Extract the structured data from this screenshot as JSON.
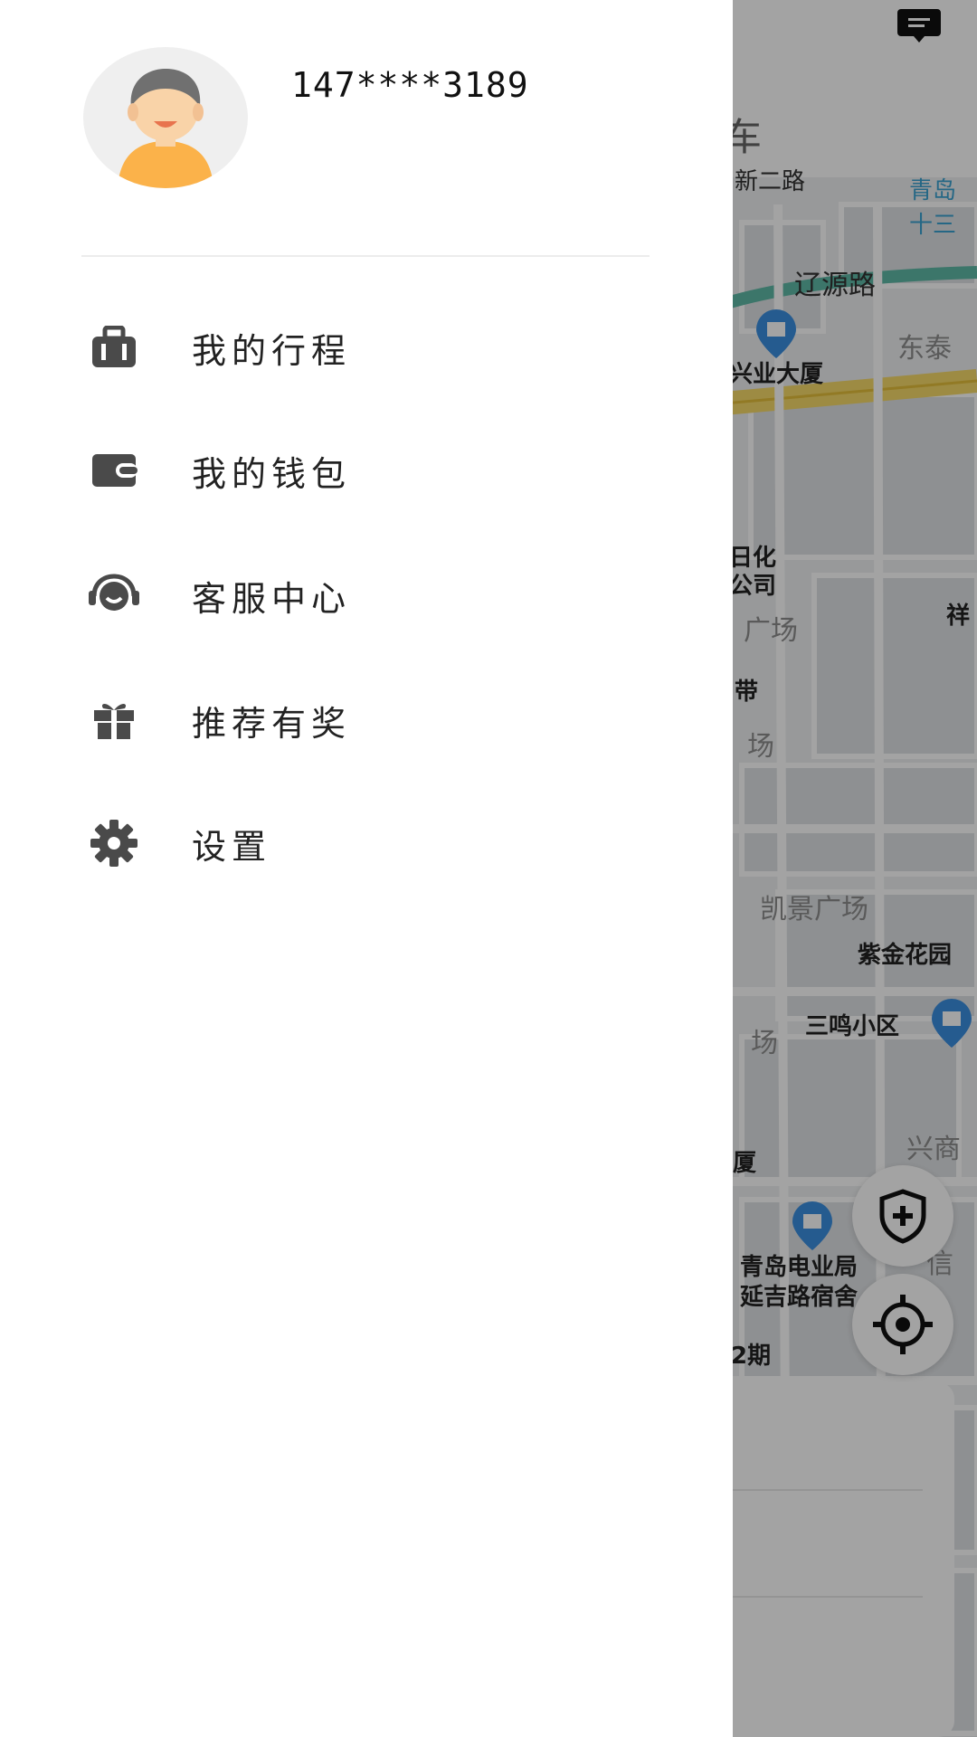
{
  "map": {
    "topbar_text": "车",
    "labels": {
      "road1": "新二路",
      "road2": "辽源路",
      "qd": "青岛",
      "sh": "十三",
      "dongtai": "东泰",
      "xingye": "兴业大厦",
      "rihua": "日化",
      "gongsi": "公司",
      "guangchang1": "广场",
      "xiang": "祥",
      "dai": "带",
      "guangchang2": "场",
      "kaijing": "凯景广场",
      "zijin": "紫金花园",
      "sanming": "三鸣小区",
      "guangchang3": "场",
      "xingshang": "兴商",
      "xia": "厦",
      "dianye": "青岛电业局",
      "yanji": "延吉路宿舍",
      "qi": "2期",
      "xin": "信"
    }
  },
  "user": {
    "phone": "147****3189"
  },
  "menu": {
    "items": [
      {
        "label": "我的行程",
        "icon": "suitcase-icon"
      },
      {
        "label": "我的钱包",
        "icon": "wallet-icon"
      },
      {
        "label": "客服中心",
        "icon": "headset-icon"
      },
      {
        "label": "推荐有奖",
        "icon": "gift-icon"
      },
      {
        "label": "设置",
        "icon": "gear-icon"
      }
    ]
  },
  "colors": {
    "icon": "#4a4a4a",
    "avatar_bg": "#efefef",
    "skin": "#f9d3a8",
    "shirt": "#fbb24a",
    "hair": "#707070",
    "map_overlay": "rgba(0,0,0,0.36)"
  }
}
